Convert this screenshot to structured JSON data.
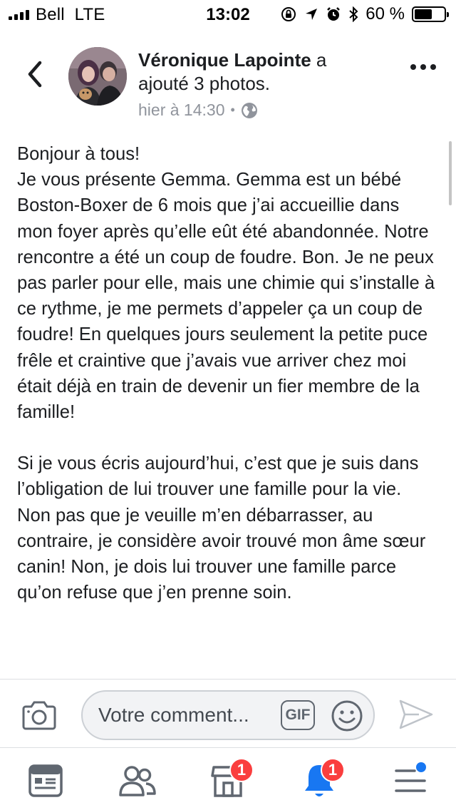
{
  "status_bar": {
    "carrier": "Bell",
    "network": "LTE",
    "time": "13:02",
    "battery_percent": "60 %",
    "battery_level": 0.6
  },
  "post": {
    "author_name": "Véronique Lapointe",
    "action": "a ajouté 3 photos.",
    "timestamp": "hier à 14:30",
    "privacy_icon": "globe-icon",
    "paragraphs": [
      "Bonjour à tous!\nJe vous présente Gemma. Gemma est un bébé Boston-Boxer de 6 mois que j’ai accueillie dans mon foyer après qu’elle eût été abandonnée. Notre rencontre a été un coup de foudre. Bon. Je ne peux pas parler pour elle, mais une chimie qui s’installe à ce rythme, je me permets d’appeler ça un coup de foudre! En quelques jours seulement la petite puce frêle et craintive que j’avais vue arriver chez moi était déjà en train de devenir un fier membre de la famille!",
      "Si je vous écris aujourd’hui, c’est que je suis dans l’obligation de lui trouver une famille pour la vie. Non pas que je veuille m’en débarrasser, au contraire, je considère avoir trouvé mon âme sœur canin! Non, je dois lui trouver une famille parce qu’on refuse que j’en prenne soin."
    ]
  },
  "comment_bar": {
    "placeholder": "Votre comment...",
    "gif_label": "GIF"
  },
  "tab_bar": {
    "marketplace_badge": "1",
    "notifications_badge": "1"
  },
  "colors": {
    "badge": "#fa3e3e",
    "notification_blue": "#1877f2",
    "icon_gray": "#606770"
  }
}
